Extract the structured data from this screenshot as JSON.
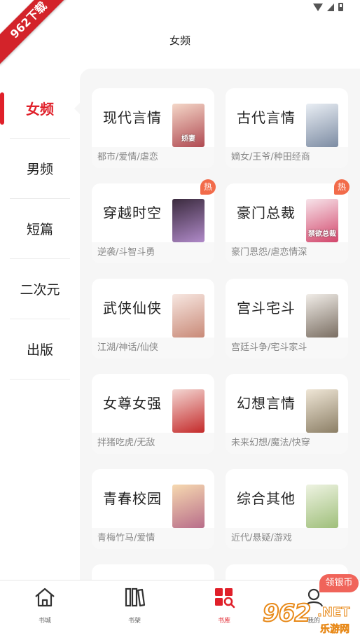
{
  "watermark_ribbon": "962下载",
  "header": {
    "title": "女频"
  },
  "sidebar": {
    "items": [
      {
        "label": "女频",
        "active": true
      },
      {
        "label": "男频",
        "active": false
      },
      {
        "label": "短篇",
        "active": false
      },
      {
        "label": "二次元",
        "active": false
      },
      {
        "label": "出版",
        "active": false
      }
    ]
  },
  "categories": [
    {
      "title": "现代言情",
      "tags": "都市/爱情/虐恋",
      "cover_text": "娇妻",
      "cover_colors": [
        "#f4d7c8",
        "#b04a52"
      ],
      "hot": false
    },
    {
      "title": "古代言情",
      "tags": "嫡女/王爷/种田经商",
      "cover_text": "",
      "cover_colors": [
        "#e9eef4",
        "#7d8ca3"
      ],
      "hot": false
    },
    {
      "title": "穿越时空",
      "tags": "逆袭/斗智斗勇",
      "cover_text": "",
      "cover_colors": [
        "#3a2a3d",
        "#b08ac9"
      ],
      "hot": true
    },
    {
      "title": "豪门总裁",
      "tags": "豪门恩怨/虐恋情深",
      "cover_text": "禁欲总裁",
      "cover_colors": [
        "#f7e4ea",
        "#d2466b"
      ],
      "hot": true
    },
    {
      "title": "武侠仙侠",
      "tags": "江湖/神话/仙侠",
      "cover_text": "",
      "cover_colors": [
        "#f7e7e1",
        "#c98a78"
      ],
      "hot": false
    },
    {
      "title": "宫斗宅斗",
      "tags": "宫廷斗争/宅斗家斗",
      "cover_text": "",
      "cover_colors": [
        "#f1ede8",
        "#7a6e62"
      ],
      "hot": false
    },
    {
      "title": "女尊女强",
      "tags": "拌猪吃虎/无敌",
      "cover_text": "",
      "cover_colors": [
        "#f3d6d2",
        "#c42a2a"
      ],
      "hot": false
    },
    {
      "title": "幻想言情",
      "tags": "未来幻想/魔法/快穿",
      "cover_text": "",
      "cover_colors": [
        "#efe6d6",
        "#8c7f66"
      ],
      "hot": false
    },
    {
      "title": "青春校园",
      "tags": "青梅竹马/爱情",
      "cover_text": "",
      "cover_colors": [
        "#f6d9b0",
        "#b86d8a"
      ],
      "hot": false
    },
    {
      "title": "综合其他",
      "tags": "近代/悬疑/游戏",
      "cover_text": "",
      "cover_colors": [
        "#eef3e2",
        "#9fbf7a"
      ],
      "hot": false
    }
  ],
  "hot_label": "热",
  "tabbar": {
    "tabs": [
      {
        "label": "书城",
        "active": false
      },
      {
        "label": "书架",
        "active": false
      },
      {
        "label": "书库",
        "active": true
      },
      {
        "label": "我的",
        "active": false
      }
    ]
  },
  "reward_badge": "领银币",
  "site_watermark": {
    "number": "962",
    "suffix": ".NET",
    "name": "乐游网"
  },
  "colors": {
    "accent": "#e0202a",
    "hot": "#f26b4a",
    "badge": "#f0645a",
    "panel_bg": "#f6f6f6"
  }
}
